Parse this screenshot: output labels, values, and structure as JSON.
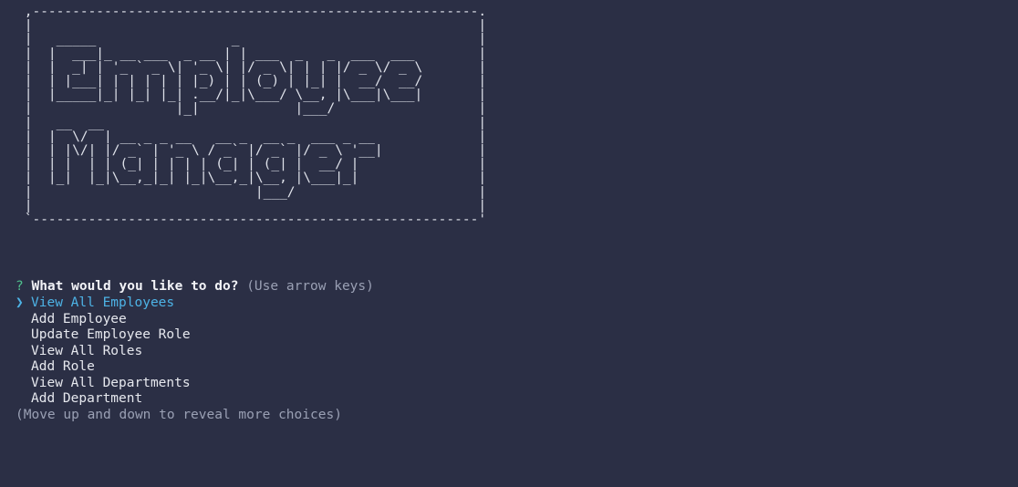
{
  "banner": {
    "art": " ,--------------------------------------------------------.\n |                                                        |\n |   _____                 _                              |\n |  |  ___|_ __ ___  _ __ | | ___  _   _  ___  ___        |\n |  |  _| | '_ ` _ \\| '_ \\| |/ _ \\| | | |/ _ \\/ _ \\       |\n |  | |___| | | | | | |_) | | (_) | |_| |  __/  __/       |\n |  |_____|_| |_| |_| .__/|_|\\___/ \\__, |\\___|\\___|       |\n |                  |_|            |___/                  |\n |   __  __                                               |\n |  |  \\/  | __ _ _ __   __ _  __ _  ___ _ __             |\n |  | |\\/| |/ _` | '_ \\ / _` |/ _` |/ _ \\ '__|            |\n |  | |  | | (_| | | | | (_| | (_| |  __/ |               |\n |  |_|  |_|\\__,_|_| |_|\\__,_|\\__, |\\___|_|               |\n |                            |___/                       |\n |                                                        |\n `--------------------------------------------------------'"
  },
  "prompt": {
    "marker": "?",
    "question": "What would you like to do?",
    "hint": "(Use arrow keys)"
  },
  "menu": {
    "pointer": "❯",
    "choices": [
      "View All Employees",
      "Add Employee",
      "Update Employee Role",
      "View All Roles",
      "Add Role",
      "View All Departments",
      "Add Department"
    ],
    "selected_index": 0,
    "more_hint": "(Move up and down to reveal more choices)"
  },
  "colors": {
    "background": "#2b2f45",
    "prompt_marker": "#4fc08d",
    "selected": "#4db3e6",
    "hint": "#9aa0b4"
  }
}
